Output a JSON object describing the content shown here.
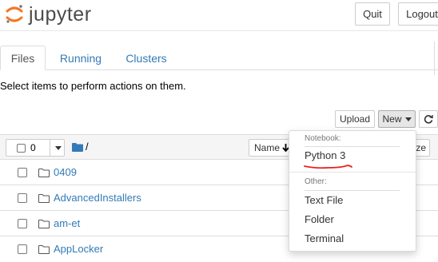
{
  "header": {
    "logo_text": "jupyter",
    "quit_label": "Quit",
    "logout_label": "Logout"
  },
  "tabs": [
    {
      "label": "Files",
      "active": true
    },
    {
      "label": "Running",
      "active": false
    },
    {
      "label": "Clusters",
      "active": false
    }
  ],
  "instructions": "Select items to perform actions on them.",
  "toolbar": {
    "upload_label": "Upload",
    "new_label": "New",
    "refresh_icon": "refresh-icon"
  },
  "list_header": {
    "selected_count": "0",
    "breadcrumb_path": "/",
    "name_sort_label": "Name",
    "last_modified_label": "ze"
  },
  "files": [
    {
      "name": "0409",
      "type": "folder"
    },
    {
      "name": "AdvancedInstallers",
      "type": "folder"
    },
    {
      "name": "am-et",
      "type": "folder"
    },
    {
      "name": "AppLocker",
      "type": "folder"
    }
  ],
  "new_menu": {
    "notebook_header": "Notebook:",
    "notebook_items": [
      "Python 3"
    ],
    "other_header": "Other:",
    "other_items": [
      "Text File",
      "Folder",
      "Terminal"
    ]
  },
  "colors": {
    "link": "#337ab7",
    "logo_orange": "#f37726",
    "annotation_red": "#e8201b"
  }
}
